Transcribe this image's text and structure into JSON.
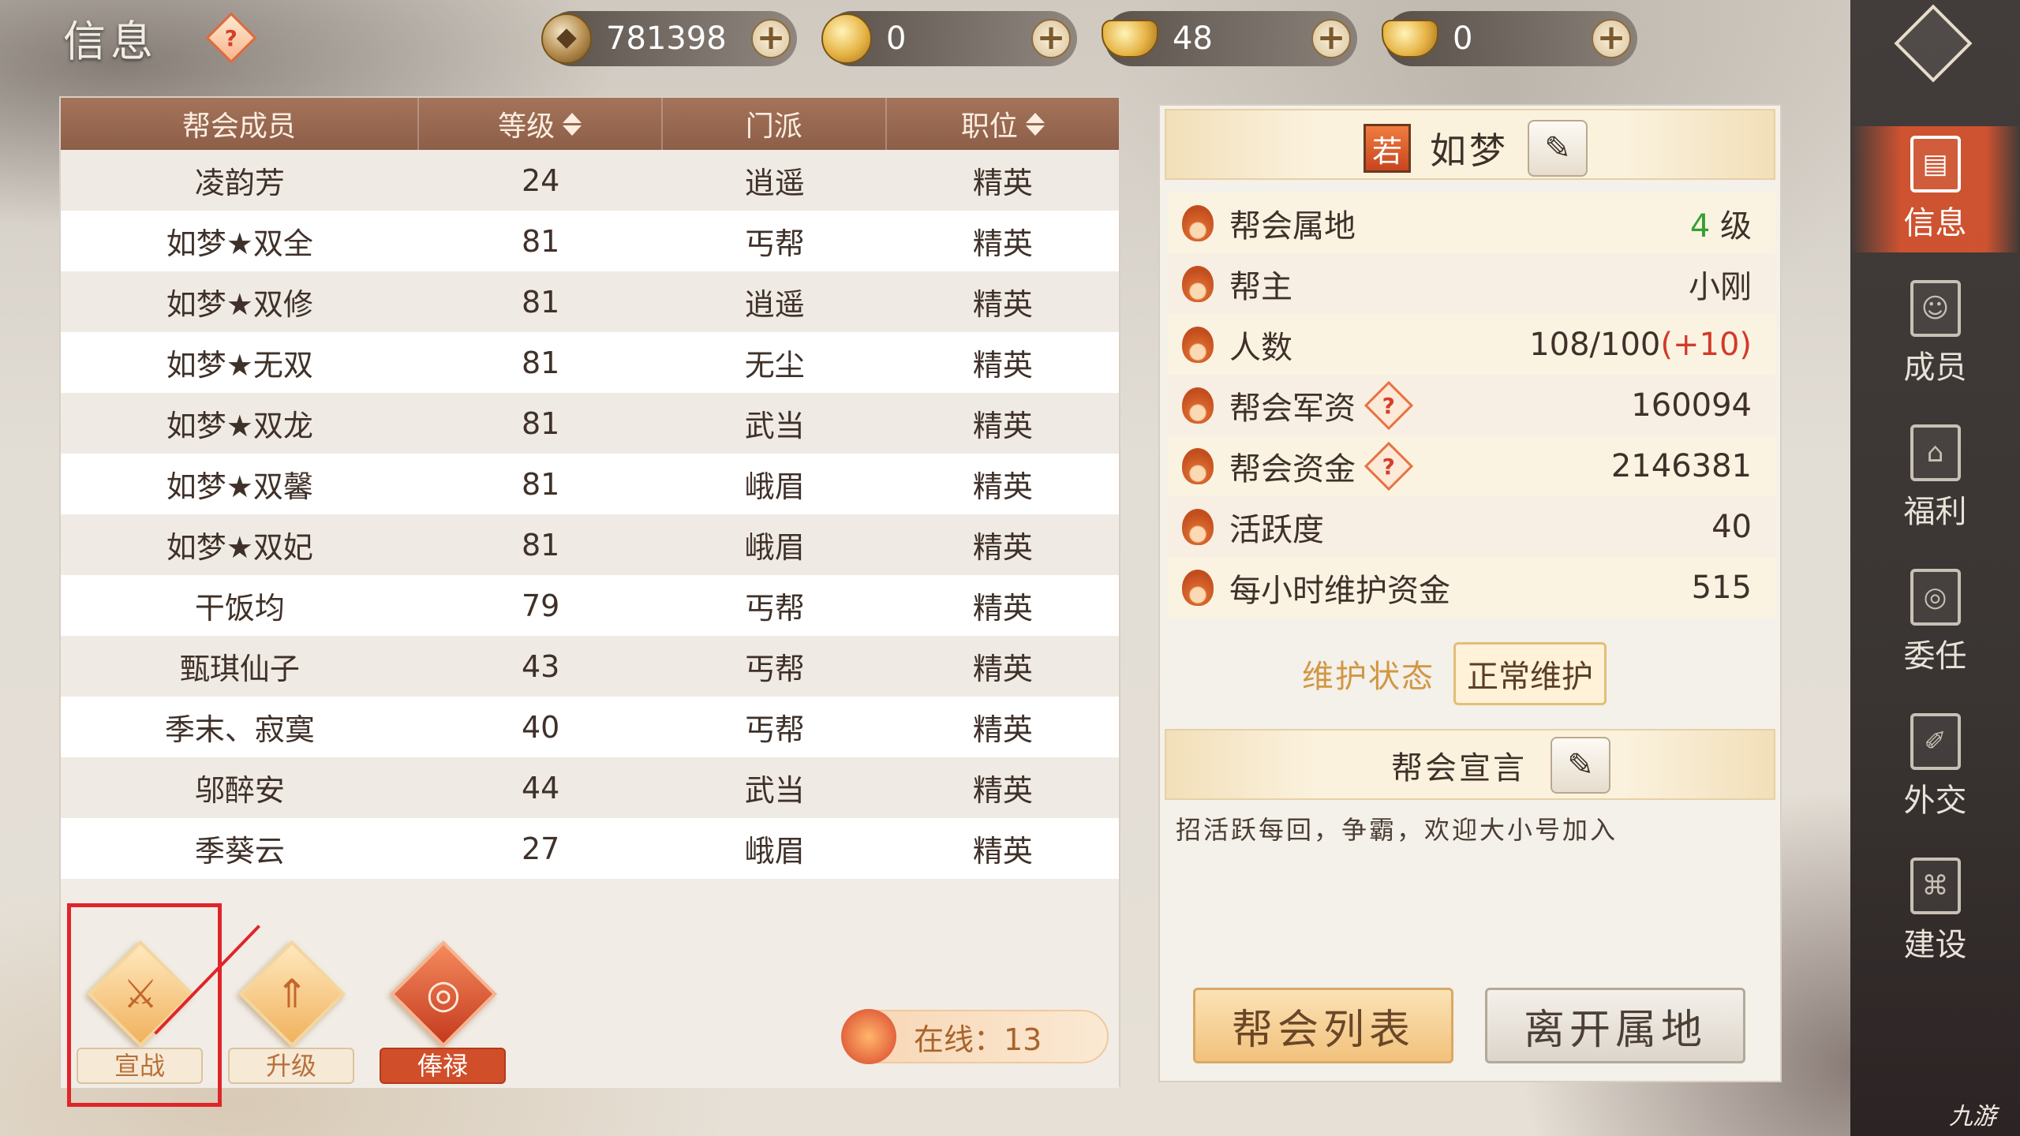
{
  "header": {
    "title": "信息",
    "help_symbol": "?",
    "currencies": [
      {
        "icon": "copper-coin-icon",
        "value": "781398"
      },
      {
        "icon": "gold-coin-icon",
        "value": "0"
      },
      {
        "icon": "bound-ingot-icon",
        "value": "48"
      },
      {
        "icon": "gold-ingot-icon",
        "value": "0"
      }
    ],
    "plus_symbol": "+"
  },
  "member_table": {
    "headers": [
      "帮会成员",
      "等级",
      "门派",
      "职位"
    ],
    "rows": [
      [
        "凌韵芳",
        "24",
        "逍遥",
        "精英"
      ],
      [
        "如梦★双全",
        "81",
        "丐帮",
        "精英"
      ],
      [
        "如梦★双修",
        "81",
        "逍遥",
        "精英"
      ],
      [
        "如梦★无双",
        "81",
        "无尘",
        "精英"
      ],
      [
        "如梦★双龙",
        "81",
        "武当",
        "精英"
      ],
      [
        "如梦★双馨",
        "81",
        "峨眉",
        "精英"
      ],
      [
        "如梦★双妃",
        "81",
        "峨眉",
        "精英"
      ],
      [
        "干饭均",
        "79",
        "丐帮",
        "精英"
      ],
      [
        "甄琪仙子",
        "43",
        "丐帮",
        "精英"
      ],
      [
        "季末、寂寞",
        "40",
        "丐帮",
        "精英"
      ],
      [
        "邬醉安",
        "44",
        "武当",
        "精英"
      ],
      [
        "季葵云",
        "27",
        "峨眉",
        "精英"
      ]
    ]
  },
  "actions": {
    "declare_war": "宣战",
    "upgrade": "升级",
    "salary": "俸禄"
  },
  "online": "在线：13",
  "guild": {
    "tag": "若",
    "name": "如梦",
    "info": [
      {
        "label": "帮会属地",
        "value_num": "4",
        "value_unit": " 级"
      },
      {
        "label": "帮主",
        "value": "小刚"
      },
      {
        "label": "人数",
        "value": "108/100",
        "bonus": "(+10)"
      },
      {
        "label": "帮会军资",
        "value": "160094",
        "help": "?"
      },
      {
        "label": "帮会资金",
        "value": "2146381",
        "help": "?"
      },
      {
        "label": "活跃度",
        "value": "40"
      },
      {
        "label": "每小时维护资金",
        "value": "515"
      }
    ],
    "maintenance_label": "维护状态",
    "maintenance_value": "正常维护",
    "declaration_title": "帮会宣言",
    "declaration_text": "招活跃每回，争霸，欢迎大小号加入",
    "list_button": "帮会列表",
    "leave_button": "离开属地"
  },
  "sidenav": {
    "items": [
      {
        "label": "信息",
        "icon": "scroll-icon",
        "active": true
      },
      {
        "label": "成员",
        "icon": "members-icon",
        "active": false
      },
      {
        "label": "福利",
        "icon": "gift-icon",
        "active": false
      },
      {
        "label": "委任",
        "icon": "appoint-icon",
        "active": false
      },
      {
        "label": "外交",
        "icon": "diplomacy-icon",
        "active": false
      },
      {
        "label": "建设",
        "icon": "build-icon",
        "active": false
      }
    ]
  },
  "watermark": "九游",
  "colors": {
    "accent": "#d6542f",
    "header_bar": "#8d5e48",
    "level_green": "#36a032",
    "bonus_red": "#d23a2a",
    "highlight_red": "#e0252a"
  }
}
